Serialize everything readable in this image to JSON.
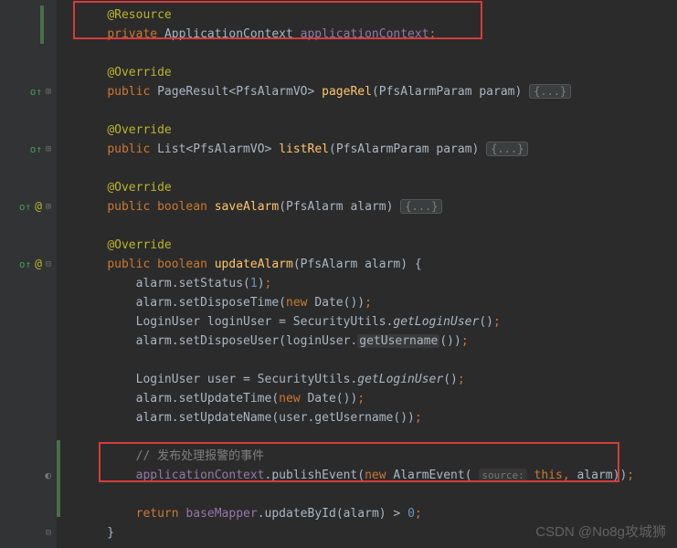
{
  "lines": {
    "l1_ann": "@Resource",
    "l2_kw": "private",
    "l2_type": "ApplicationContext",
    "l2_field": "applicationContext",
    "l4_ann": "@Override",
    "l5_kw": "public",
    "l5_ret": "PageResult",
    "l5_gen": "PfsAlarmVO",
    "l5_method": "pageRel",
    "l5_ptype": "PfsAlarmParam",
    "l5_pname": "param",
    "l7_ann": "@Override",
    "l8_kw": "public",
    "l8_ret": "List",
    "l8_gen": "PfsAlarmVO",
    "l8_method": "listRel",
    "l8_ptype": "PfsAlarmParam",
    "l8_pname": "param",
    "l10_ann": "@Override",
    "l11_kw": "public",
    "l11_ret": "boolean",
    "l11_method": "saveAlarm",
    "l11_ptype": "PfsAlarm",
    "l11_pname": "alarm",
    "l13_ann": "@Override",
    "l14_kw": "public",
    "l14_ret": "boolean",
    "l14_method": "updateAlarm",
    "l14_ptype": "PfsAlarm",
    "l14_pname": "alarm",
    "l15": "alarm.setStatus(",
    "l15_num": "1",
    "l16a": "alarm.setDisposeTime(",
    "l16_new": "new",
    "l16_type": "Date",
    "l17": "LoginUser loginUser = SecurityUtils.",
    "l17_m": "getLoginUser",
    "l18a": "alarm.setDisposeUser(loginUser.",
    "l18_m": "getUsername",
    "l20": "LoginUser user = SecurityUtils.",
    "l20_m": "getLoginUser",
    "l21a": "alarm.setUpdateTime(",
    "l21_new": "new",
    "l21_type": "Date",
    "l22": "alarm.setUpdateName(user.getUsername())",
    "l24_comment": "// 发布处理报警的事件",
    "l25_obj": "applicationContext",
    "l25_m": "publishEvent",
    "l25_new": "new",
    "l25_type": "AlarmEvent",
    "l25_hint": "source:",
    "l25_this": "this",
    "l25_arg": "alarm",
    "l27_ret": "return",
    "l27_obj": "baseMapper",
    "l27_m": "updateById",
    "l27_arg": "alarm",
    "l27_num": "0",
    "folded": "{...}"
  },
  "watermark": "CSDN @No8g攻城狮",
  "colors": {
    "bg": "#2b2b2b",
    "keyword": "#cc7832",
    "annotation": "#bbb529",
    "method": "#ffc66d",
    "field": "#9876aa",
    "number": "#6897bb",
    "comment": "#808080",
    "red_box": "#d43c3c"
  }
}
